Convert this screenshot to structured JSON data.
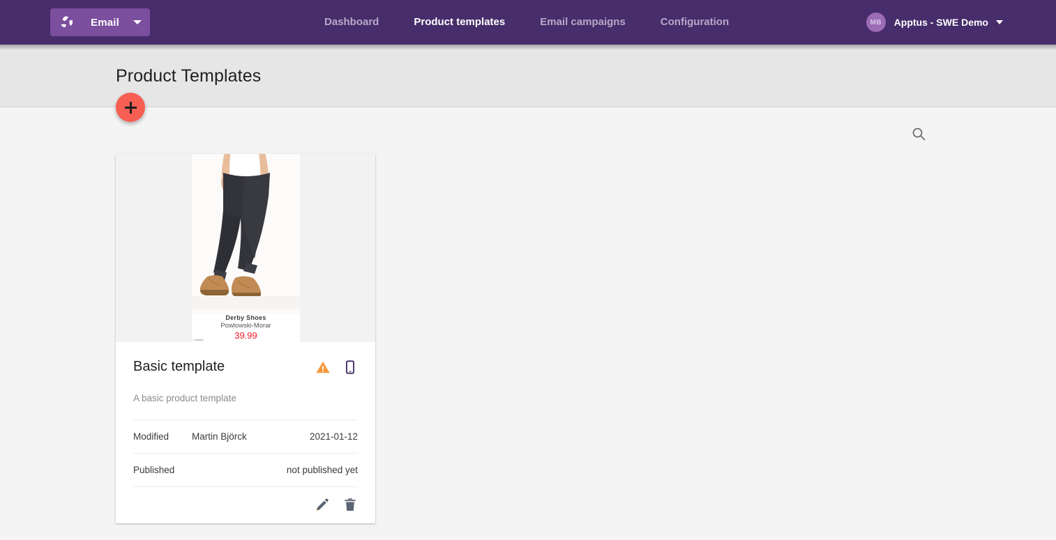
{
  "topbar": {
    "brand": {
      "label": "Email",
      "logo_icon": "pinwheel-logo-icon",
      "caret_icon": "chevron-down-icon"
    },
    "nav": [
      {
        "label": "Dashboard",
        "active": false
      },
      {
        "label": "Product templates",
        "active": true
      },
      {
        "label": "Email campaigns",
        "active": false
      },
      {
        "label": "Configuration",
        "active": false
      }
    ],
    "account": {
      "initials": "MB",
      "name": "Apptus - SWE Demo",
      "caret_icon": "chevron-down-icon"
    },
    "colors": {
      "bar": "#472d6b",
      "brand_button": "#7b4e9e",
      "avatar": "#9b6bb5"
    }
  },
  "header": {
    "title": "Product Templates",
    "add_button": {
      "icon": "plus-icon",
      "color": "#f65f52"
    }
  },
  "toolbar": {
    "search": {
      "icon": "search-icon",
      "label": "Search"
    }
  },
  "cards": [
    {
      "title": "Basic template",
      "description": "A basic product template",
      "status_icon": "warning-triangle-icon",
      "device_icon": "smartphone-icon",
      "thumbnail": {
        "product_name": "Derby Shoes",
        "brand": "Powlowski-Morar",
        "price": "39.99",
        "collapse_label": "Collapse",
        "price_color": "#ee1c25"
      },
      "meta": [
        {
          "label": "Modified",
          "value": "Martin Björck",
          "right": "2021-01-12",
          "right_warn": false
        },
        {
          "label": "Published",
          "value": "",
          "right": "not published yet",
          "right_warn": true
        }
      ],
      "actions": [
        {
          "name": "edit",
          "icon": "pencil-icon"
        },
        {
          "name": "delete",
          "icon": "trash-icon"
        }
      ]
    }
  ]
}
